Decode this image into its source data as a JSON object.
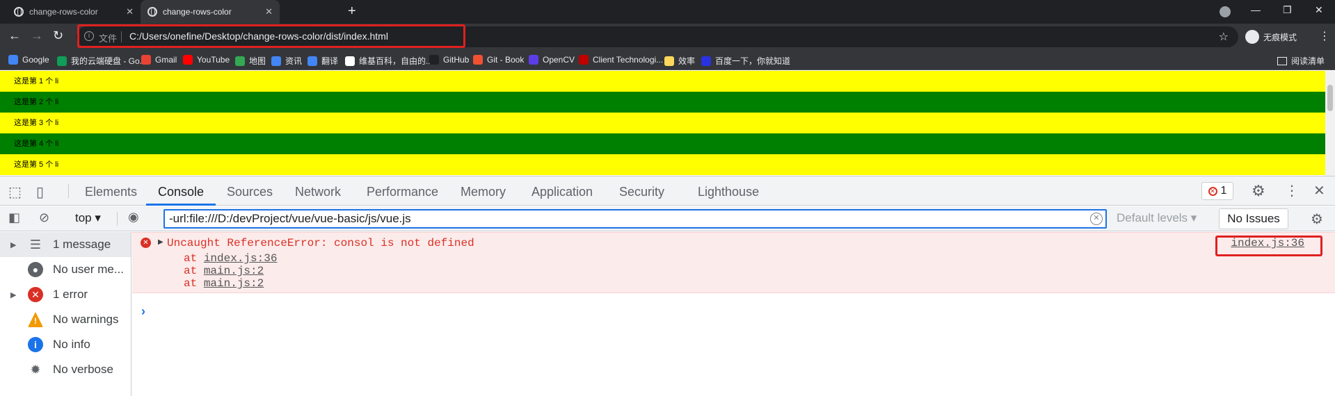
{
  "browser": {
    "tabs": [
      {
        "title": "change-rows-color",
        "active": false
      },
      {
        "title": "change-rows-color",
        "active": true
      }
    ],
    "new_tab_icon": "plus-icon",
    "address": {
      "scheme_label": "文件",
      "url": "C:/Users/onefine/Desktop/change-rows-color/dist/index.html"
    },
    "profile_label": "无痕模式",
    "bookmarks": [
      {
        "label": "Google",
        "color": "#4285f4"
      },
      {
        "label": "我的云端硬盘 - Go...",
        "color": "#0f9d58"
      },
      {
        "label": "Gmail",
        "color": "#ea4335"
      },
      {
        "label": "YouTube",
        "color": "#ff0000"
      },
      {
        "label": "地图",
        "color": "#34a853"
      },
      {
        "label": "资讯",
        "color": "#4285f4"
      },
      {
        "label": "翻译",
        "color": "#4285f4"
      },
      {
        "label": "维基百科，自由的...",
        "color": "#ffffff"
      },
      {
        "label": "GitHub",
        "color": "#202124"
      },
      {
        "label": "Git - Book",
        "color": "#f05133"
      },
      {
        "label": "OpenCV",
        "color": "#5c3ee8"
      },
      {
        "label": "Client Technologi...",
        "color": "#c00000"
      },
      {
        "label": "效率",
        "color": "#fbd75b"
      },
      {
        "label": "百度一下，你就知道",
        "color": "#2932e1"
      }
    ],
    "reading_list": "阅读清单"
  },
  "page": {
    "rows": [
      {
        "text": "这是第 1 个 li",
        "color": "#ffff00"
      },
      {
        "text": "这是第 2 个 li",
        "color": "#008000"
      },
      {
        "text": "这是第 3 个 li",
        "color": "#ffff00"
      },
      {
        "text": "这是第 4 个 li",
        "color": "#008000"
      },
      {
        "text": "这是第 5 个 li",
        "color": "#ffff00"
      }
    ]
  },
  "devtools": {
    "tabs": [
      "Elements",
      "Console",
      "Sources",
      "Network",
      "Performance",
      "Memory",
      "Application",
      "Security",
      "Lighthouse"
    ],
    "active_tab": "Console",
    "error_count": "1",
    "console": {
      "context": "top",
      "filter_value": "-url:file:///D:/devProject/vue/vue-basic/js/vue.js",
      "levels": "Default levels",
      "issues": "No Issues"
    },
    "sidebar": [
      {
        "label": "1 message",
        "icon": "list-icon",
        "expandable": true,
        "selected": true
      },
      {
        "label": "No user me...",
        "icon": "user-icon",
        "expandable": false,
        "selected": false
      },
      {
        "label": "1 error",
        "icon": "error-icon",
        "expandable": true,
        "selected": false
      },
      {
        "label": "No warnings",
        "icon": "warning-icon",
        "expandable": false,
        "selected": false
      },
      {
        "label": "No info",
        "icon": "info-icon",
        "expandable": false,
        "selected": false
      },
      {
        "label": "No verbose",
        "icon": "bug-icon",
        "expandable": false,
        "selected": false
      }
    ],
    "error": {
      "message": "Uncaught ReferenceError: consol is not defined",
      "source": "index.js:36",
      "stack": [
        {
          "at": "at",
          "file": "index.js:36"
        },
        {
          "at": "at",
          "file": "main.js:2"
        },
        {
          "at": "at",
          "file": "main.js:2"
        }
      ]
    },
    "prompt": "›"
  }
}
